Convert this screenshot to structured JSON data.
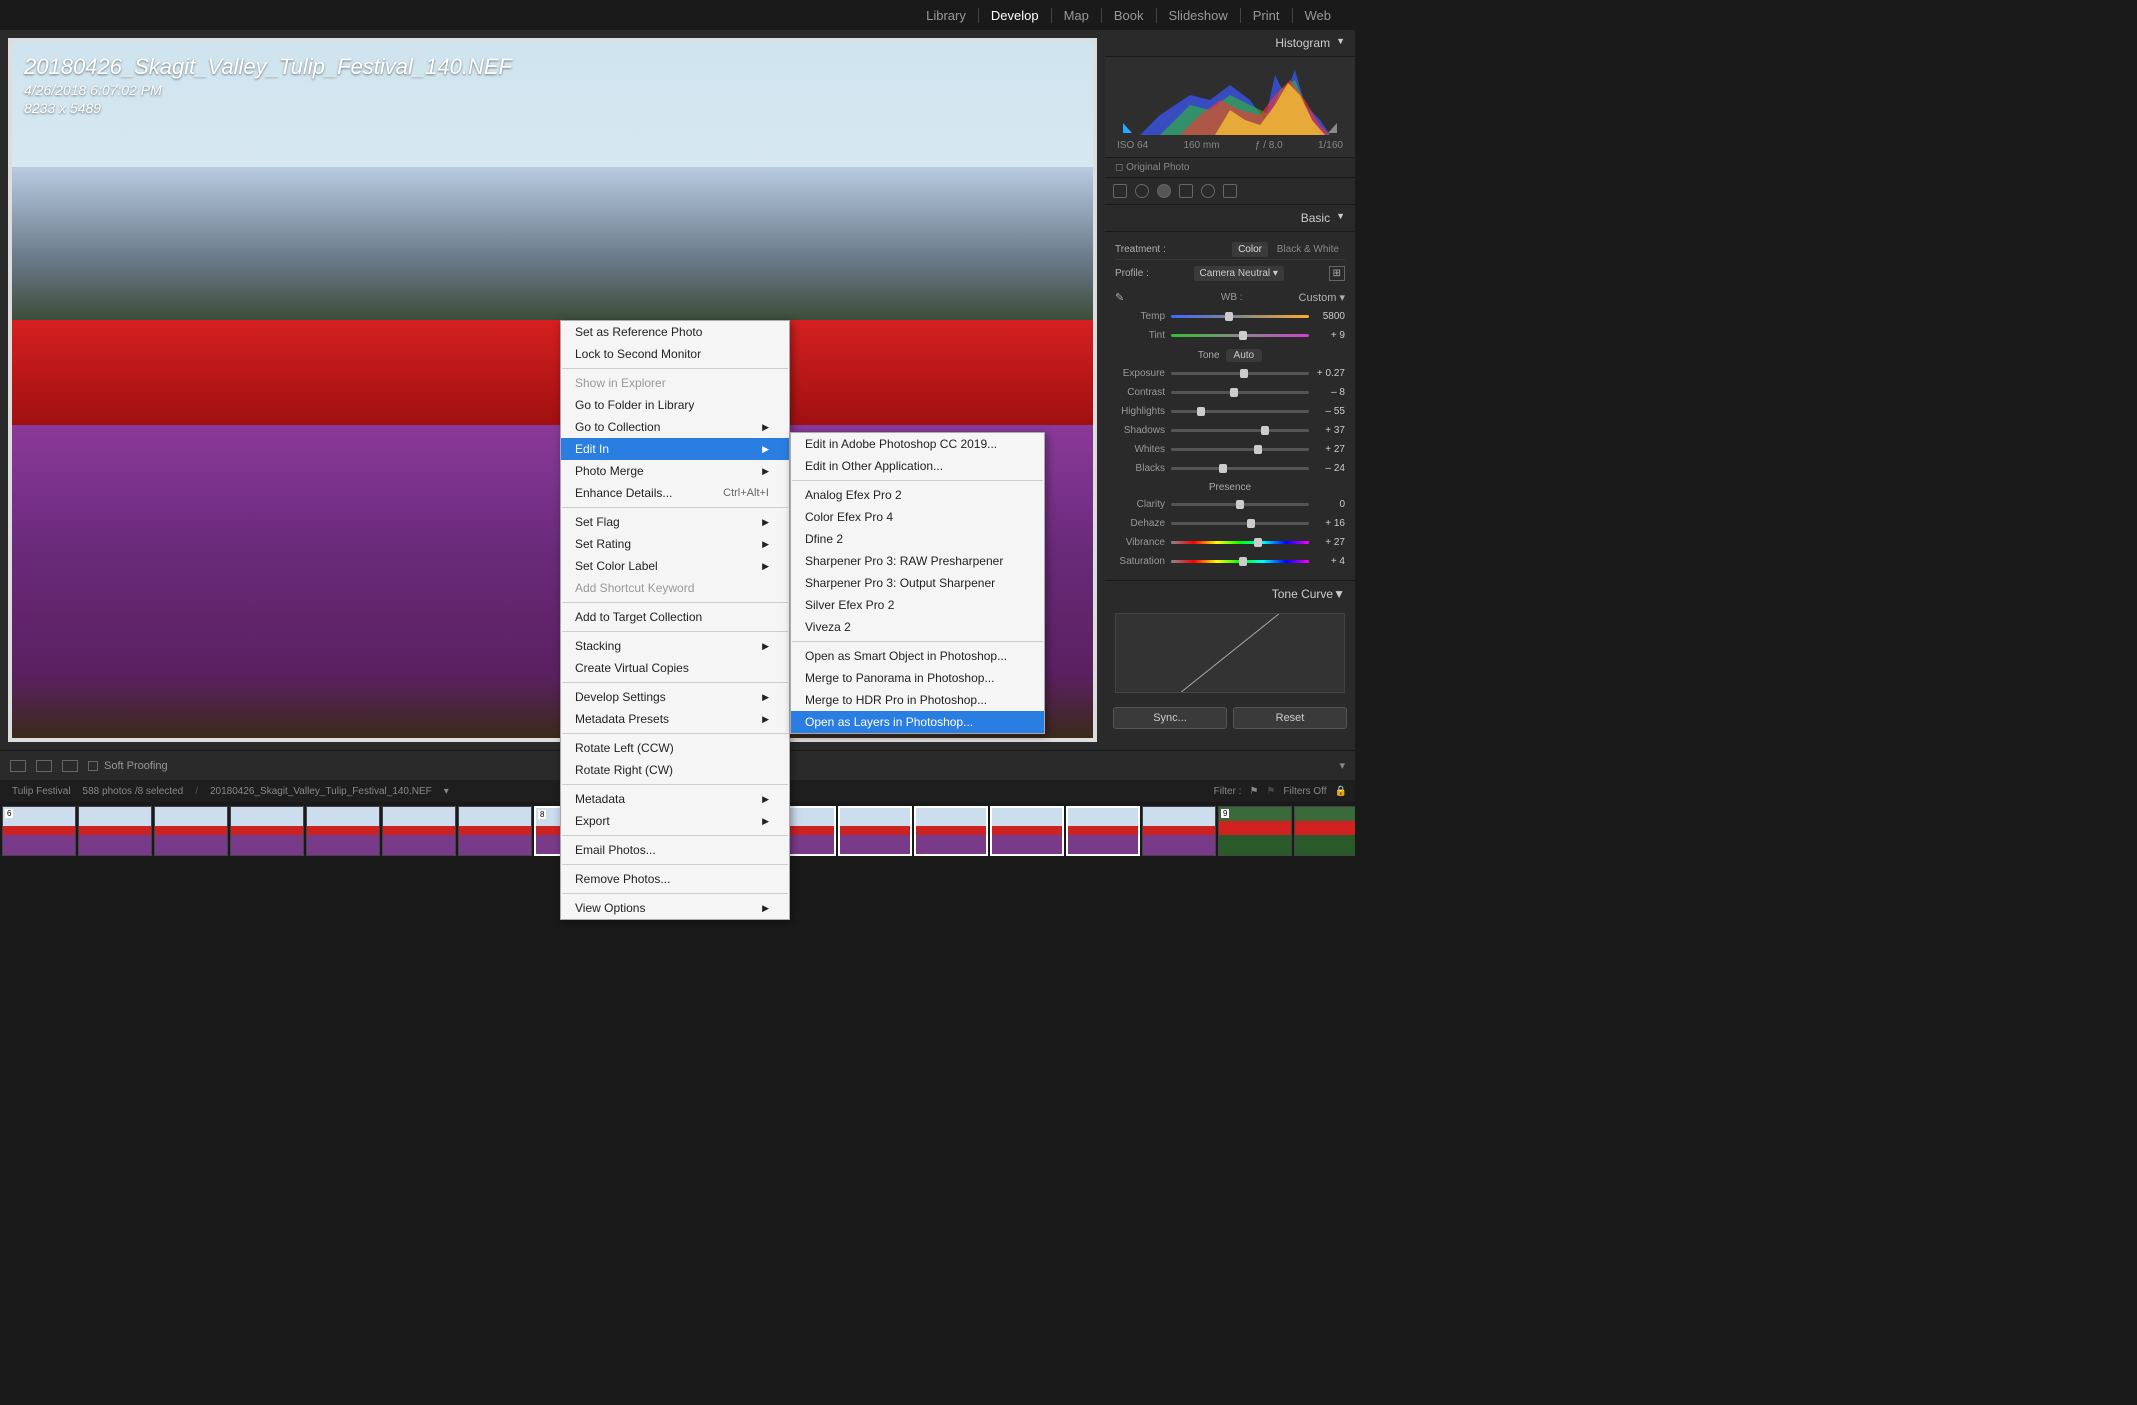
{
  "nav": {
    "items": [
      "Library",
      "Develop",
      "Map",
      "Book",
      "Slideshow",
      "Print",
      "Web"
    ],
    "active": "Develop"
  },
  "image_overlay": {
    "filename": "20180426_Skagit_Valley_Tulip_Festival_140.NEF",
    "datetime": "4/26/2018 6:07:02 PM",
    "dimensions": "8233 x 5489"
  },
  "histogram": {
    "title": "Histogram",
    "iso": "ISO 64",
    "focal": "160 mm",
    "aperture": "ƒ / 8.0",
    "shutter": "1/160",
    "original_photo": "Original Photo"
  },
  "basic": {
    "title": "Basic",
    "treatment_label": "Treatment :",
    "color": "Color",
    "bw": "Black & White",
    "profile_label": "Profile :",
    "profile_value": "Camera Neutral",
    "wb_label": "WB :",
    "wb_value": "Custom",
    "temp_label": "Temp",
    "temp_value": "5800",
    "tint_label": "Tint",
    "tint_value": "+ 9",
    "tone_label": "Tone",
    "auto": "Auto",
    "exposure_label": "Exposure",
    "exposure_value": "+ 0.27",
    "contrast_label": "Contrast",
    "contrast_value": "– 8",
    "highlights_label": "Highlights",
    "highlights_value": "– 55",
    "shadows_label": "Shadows",
    "shadows_value": "+ 37",
    "whites_label": "Whites",
    "whites_value": "+ 27",
    "blacks_label": "Blacks",
    "blacks_value": "– 24",
    "presence_label": "Presence",
    "clarity_label": "Clarity",
    "clarity_value": "0",
    "dehaze_label": "Dehaze",
    "dehaze_value": "+ 16",
    "vibrance_label": "Vibrance",
    "vibrance_value": "+ 27",
    "saturation_label": "Saturation",
    "saturation_value": "+ 4"
  },
  "tone_curve": {
    "title": "Tone Curve"
  },
  "buttons": {
    "sync": "Sync...",
    "reset": "Reset"
  },
  "toolbar": {
    "soft_proofing": "Soft Proofing"
  },
  "crumb": {
    "folder": "Tulip Festival",
    "count": "588 photos /8 selected",
    "path": "20180426_Skagit_Valley_Tulip_Festival_140.NEF",
    "filter_label": "Filter :",
    "filters_off": "Filters Off"
  },
  "filmstrip": {
    "badge_6": "6",
    "badge_8": "8",
    "badge_9": "9"
  },
  "context_menu_1": [
    {
      "label": "Set as Reference Photo"
    },
    {
      "label": "Lock to Second Monitor"
    },
    {
      "sep": true
    },
    {
      "label": "Show in Explorer",
      "disabled": true
    },
    {
      "label": "Go to Folder in Library"
    },
    {
      "label": "Go to Collection",
      "sub": true
    },
    {
      "label": "Edit In",
      "sub": true,
      "hl": true
    },
    {
      "label": "Photo Merge",
      "sub": true
    },
    {
      "label": "Enhance Details...",
      "shortcut": "Ctrl+Alt+I"
    },
    {
      "sep": true
    },
    {
      "label": "Set Flag",
      "sub": true
    },
    {
      "label": "Set Rating",
      "sub": true
    },
    {
      "label": "Set Color Label",
      "sub": true
    },
    {
      "label": "Add Shortcut Keyword",
      "disabled": true
    },
    {
      "sep": true
    },
    {
      "label": "Add to Target Collection"
    },
    {
      "sep": true
    },
    {
      "label": "Stacking",
      "sub": true
    },
    {
      "label": "Create Virtual Copies"
    },
    {
      "sep": true
    },
    {
      "label": "Develop Settings",
      "sub": true
    },
    {
      "label": "Metadata Presets",
      "sub": true
    },
    {
      "sep": true
    },
    {
      "label": "Rotate Left (CCW)"
    },
    {
      "label": "Rotate Right (CW)"
    },
    {
      "sep": true
    },
    {
      "label": "Metadata",
      "sub": true
    },
    {
      "label": "Export",
      "sub": true
    },
    {
      "sep": true
    },
    {
      "label": "Email Photos..."
    },
    {
      "sep": true
    },
    {
      "label": "Remove Photos..."
    },
    {
      "sep": true
    },
    {
      "label": "View Options",
      "sub": true
    }
  ],
  "context_menu_2": [
    {
      "label": "Edit in Adobe Photoshop CC 2019..."
    },
    {
      "label": "Edit in Other Application..."
    },
    {
      "sep": true
    },
    {
      "label": "Analog Efex Pro 2"
    },
    {
      "label": "Color Efex Pro 4"
    },
    {
      "label": "Dfine 2"
    },
    {
      "label": "Sharpener Pro 3: RAW Presharpener"
    },
    {
      "label": "Sharpener Pro 3: Output Sharpener"
    },
    {
      "label": "Silver Efex Pro 2"
    },
    {
      "label": "Viveza 2"
    },
    {
      "sep": true
    },
    {
      "label": "Open as Smart Object in Photoshop..."
    },
    {
      "label": "Merge to Panorama in Photoshop..."
    },
    {
      "label": "Merge to HDR Pro in Photoshop..."
    },
    {
      "label": "Open as Layers in Photoshop...",
      "hl": true
    }
  ]
}
